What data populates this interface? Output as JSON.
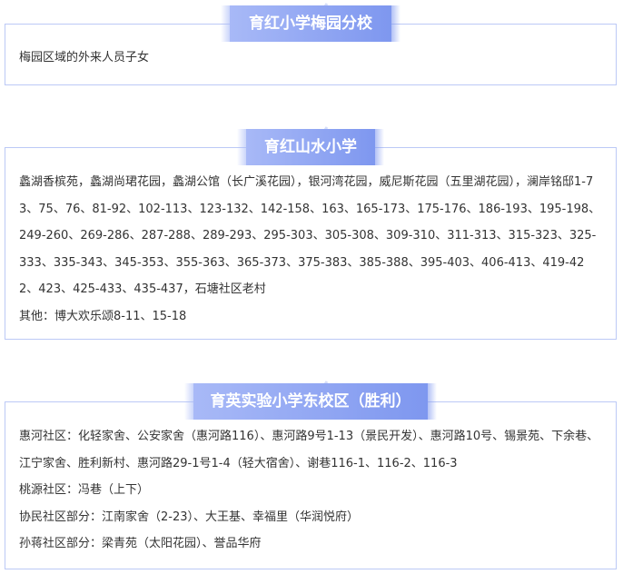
{
  "sections": [
    {
      "title": "育红小学梅园分校",
      "lines": [
        "梅园区域的外来人员子女"
      ]
    },
    {
      "title": "育红山水小学",
      "lines": [
        "蠡湖香槟苑，蠡湖尚珺花园，蠡湖公馆（长广溪花园），银河湾花园，威尼斯花园（五里湖花园），澜岸铭邸1-73、75、76、81-92、102-113、123-132、142-158、163、165-173、175-176、186-193、195-198、249-260、269-286、287-288、289-293、295-303、305-308、309-310、311-313、315-323、325-333、335-343、345-353、355-363、365-373、375-383、385-388、395-403、406-413、419-422、423、425-433、435-437，石塘社区老村",
        "其他：博大欢乐颂8-11、15-18"
      ]
    },
    {
      "title": "育英实验小学东校区（胜利）",
      "lines": [
        "惠河社区：化轻家舍、公安家舍（惠河路116）、惠河路9号1-13（景民开发）、惠河路10号、锡景苑、下余巷、江宁家舍、胜利新村、惠河路29-1号1-4（轻大宿舍）、谢巷116-1、116-2、116-3",
        "桃源社区：冯巷（上下）",
        "协民社区部分：江南家舍（2-23）、大王基、幸福里（华润悦府）",
        "孙蒋社区部分：梁青苑（太阳花园）、誉品华府"
      ]
    }
  ]
}
